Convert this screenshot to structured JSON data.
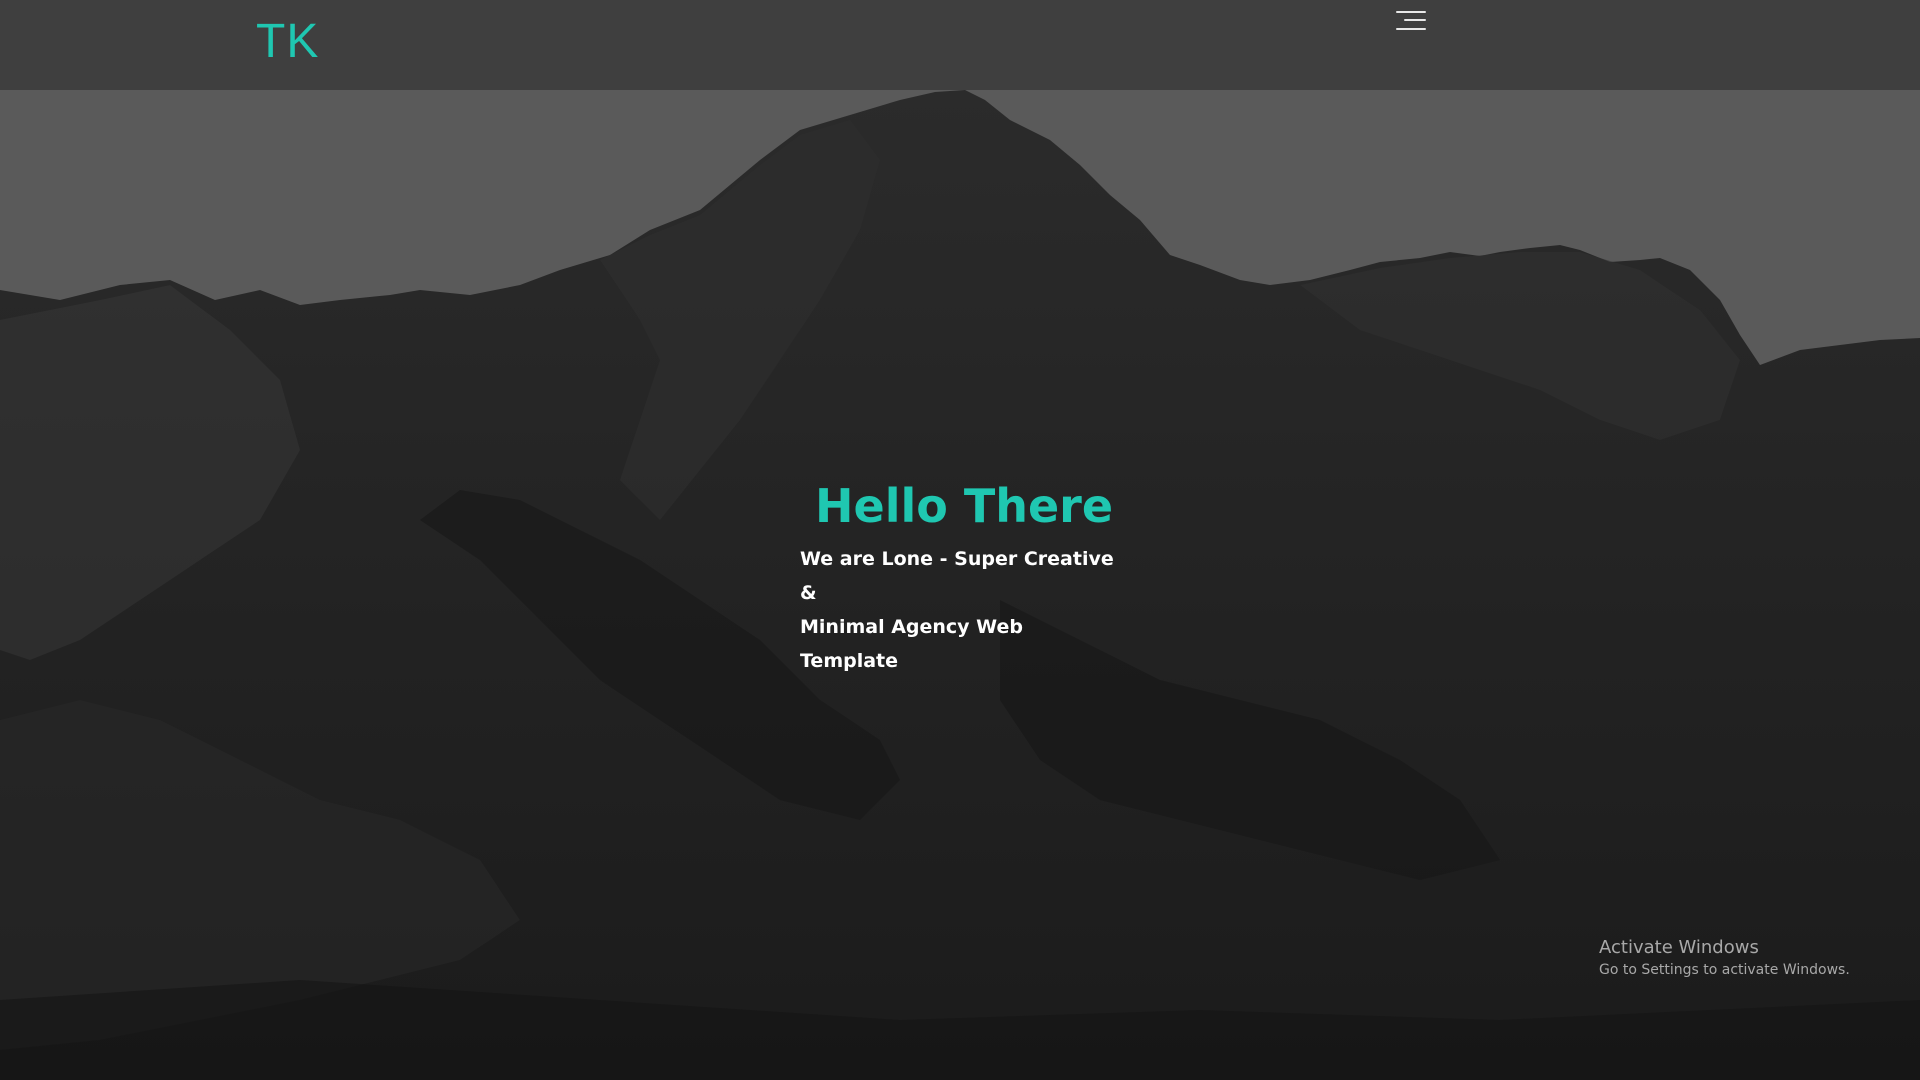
{
  "header": {
    "logo": "TK",
    "menu_icon": "hamburger-menu-icon"
  },
  "hero": {
    "title": "Hello There",
    "subtitle_line1": "We are Lone - Super Creative &",
    "subtitle_line2": "Minimal Agency Web Template"
  },
  "watermark": {
    "title": "Activate Windows",
    "subtitle": "Go to Settings to activate Windows."
  },
  "colors": {
    "accent": "#1fc7b1",
    "header_bg": "#3f3f3f",
    "sky": "#5a5a5a",
    "mountain_dark": "#1d1d1d",
    "hero_text": "#ffffff"
  }
}
